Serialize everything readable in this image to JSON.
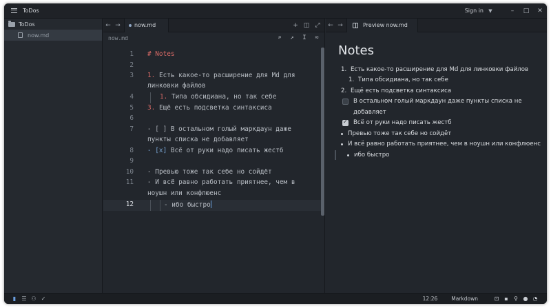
{
  "window": {
    "title": "ToDos",
    "sign_in": "Sign in"
  },
  "sidebar": {
    "root": "ToDos",
    "files": [
      "now.md"
    ]
  },
  "editor": {
    "tab_label": "now.md",
    "path": "now.md",
    "lines": [
      {
        "n": "1"
      },
      {
        "n": "2"
      },
      {
        "n": "3"
      },
      {
        "n": "4"
      },
      {
        "n": "5"
      },
      {
        "n": "6"
      },
      {
        "n": "7"
      },
      {
        "n": "8"
      },
      {
        "n": "9"
      },
      {
        "n": "10"
      },
      {
        "n": "11"
      },
      {
        "n": "12"
      }
    ],
    "text": {
      "l1": "# Notes",
      "l3_num": "1.",
      "l3a": " Есть какое-то расширение для Md для",
      "l3b": "линковки файлов",
      "l4_num": "1.",
      "l4": " Типа обсидиана, но так себе",
      "l5_num": "3.",
      "l5": " Ещё есть подсветка синтаксиса",
      "l7_mark": "- [ ]",
      "l7a": " В остальном голый маркдаун даже",
      "l7b": "пункты списка не добавляет",
      "l8_mark": "- [x]",
      "l8": " Всё от руки надо писать жестб",
      "l10_mark": "-",
      "l10": " Превью тоже так себе но сойдёт",
      "l11_mark": "-",
      "l11a": " И всё равно работать приятнее, чем в",
      "l11b": "ноушн или конфлюенс",
      "l12_mark": "-",
      "l12": " ибо быстро"
    }
  },
  "preview": {
    "tab_label": "Preview now.md",
    "title": "Notes",
    "items": {
      "o1_num": "1.",
      "o1": "Есть какое-то расширение для Md для линковки файлов",
      "o1a_num": "1.",
      "o1a": "Типа обсидиана, но так себе",
      "o2_num": "2.",
      "o2": "Ещё есть подсветка синтаксиса",
      "t1a": "В остальном голый маркдаун даже пункты списка не",
      "t1b": "добавляет",
      "t2": "Всё от руки надо писать жестб",
      "b1": "Превью тоже так себе но сойдёт",
      "b2": "И всё равно работать приятнее, чем в ноушн или конфлюенс",
      "b2a": "ибо быстро"
    },
    "task_states": [
      false,
      true
    ]
  },
  "status": {
    "time": "12:26",
    "language": "Markdown"
  },
  "colors": {
    "heading": "#d86a66",
    "list_marker": "#7aa7d6",
    "accent": "#6ca3e0",
    "background": "#22262c"
  }
}
